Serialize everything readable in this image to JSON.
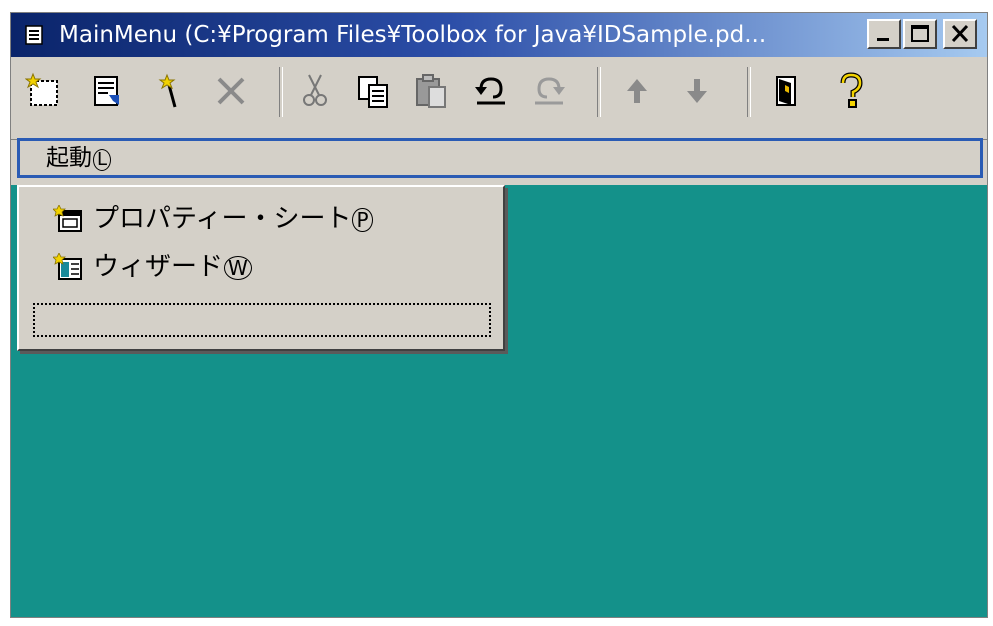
{
  "window": {
    "title": "MainMenu (C:¥Program Files¥Toolbox for Java¥IDSample.pd...",
    "minimize_glyph": "_",
    "maximize_glyph": "□",
    "close_glyph": "✕"
  },
  "toolbar": {
    "tools": [
      "new-icon",
      "properties-icon",
      "wizard-icon",
      "delete-icon",
      "cut-icon",
      "copy-icon",
      "paste-icon",
      "undo-icon",
      "redo-icon",
      "move-up-icon",
      "move-down-icon",
      "exit-icon",
      "help-icon"
    ]
  },
  "menubar": {
    "items": [
      {
        "label": "起動",
        "mnemonic": "L"
      }
    ]
  },
  "dropdown": {
    "items": [
      {
        "label": "プロパティー・シート",
        "mnemonic": "P"
      },
      {
        "label": "ウィザード",
        "mnemonic": "W"
      }
    ]
  },
  "colors": {
    "desktop": "#14918a",
    "title_start": "#0a246a",
    "title_end": "#a6caf0",
    "face": "#d4d0c8"
  }
}
